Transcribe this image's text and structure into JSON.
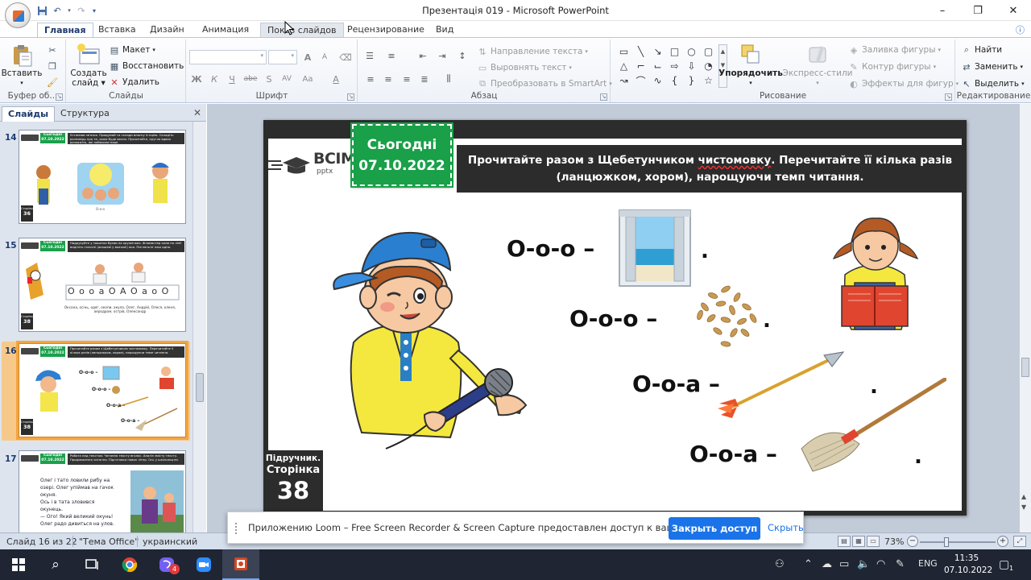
{
  "window": {
    "title": "Презентація 019 - Microsoft PowerPoint",
    "controls": {
      "minimize": "–",
      "maximize": "❐",
      "close": "✕"
    }
  },
  "qat": [
    "save-icon",
    "undo-icon",
    "redo-icon",
    "customize-icon"
  ],
  "ribbon_tabs": [
    "Главная",
    "Вставка",
    "Дизайн",
    "Анимация",
    "Показ слайдов",
    "Рецензирование",
    "Вид"
  ],
  "active_tab": "Главная",
  "ribbon": {
    "clipboard": {
      "label": "Буфер об...",
      "paste": "Вставить"
    },
    "slides": {
      "label": "Слайды",
      "create": "Создать",
      "create2": "слайд",
      "layout": "Макет",
      "reset": "Восстановить",
      "delete": "Удалить"
    },
    "font": {
      "label": "Шрифт",
      "grow": "A",
      "shrink": "A",
      "bold": "Ж",
      "italic": "К",
      "underline": "Ч",
      "strike": "abe",
      "shadow": "S",
      "spacing": "AV",
      "case": "Aa",
      "color": "A"
    },
    "paragraph": {
      "label": "Абзац",
      "text_direction": "Направление текста",
      "align_text": "Выровнять текст",
      "smartart": "Преобразовать в SmartArt"
    },
    "drawing": {
      "label": "Рисование",
      "arrange": "Упорядочить",
      "quick_styles": "Экспресс-стили",
      "fill": "Заливка фигуры",
      "outline": "Контур фигуры",
      "effects": "Эффекты для фигур"
    },
    "editing": {
      "label": "Редактирование",
      "find": "Найти",
      "replace": "Заменить",
      "select": "Выделить"
    }
  },
  "panel_tabs": [
    "Слайды",
    "Структура"
  ],
  "thumbnails": [
    {
      "num": "14",
      "bar_text": "Установи зв'язок. Придумай та склади власну історію. Складіть розповідь про те, якою буде весна. Прочитайте, кругло вдвох розкажіть, які побачили наші.",
      "page": "36"
    },
    {
      "num": "15",
      "bar_text": "Надрукуйте у зошитах букви на кружечках. Фломастер коли по лінії виділіть голосні (акашеві у вказані) яка. Погляньте наш одна.",
      "page": "38",
      "row": "О о о а О А О а о О",
      "caption": "Оксана, осінь, одяг, окопи, акула, Олег, Андрій, Олеся, оленя, аеродром, острів, Олександр"
    },
    {
      "num": "16",
      "bar_text": "Прочитайте разом з Щебетунчиком чистомовку. Перечитайте її кілька разів (ланцюжком, хором), нарощуючи темп читання.",
      "page": "38",
      "lines": [
        "О-о-о –",
        "О-о-о –",
        "О-о-а –",
        "О-о-а –"
      ]
    },
    {
      "num": "17",
      "bar_text": "Робота над текстом. Читання тексту вголос. Аналіз змісту тексту. Продовження читання. Підготовка нових літер. Ось у шкільництві.",
      "page": "38",
      "text_lines": [
        "Олег і тато ловили рибу на",
        "озері. Олег упіймав на гачок",
        "окуня.",
        "Ось і в тата зловився",
        "окунець.",
        "— Ого! Який великий окунь!",
        "Олег радо дивиться на улов."
      ]
    }
  ],
  "slide": {
    "brand": {
      "name": "ВСІМ",
      "sub": "pptx"
    },
    "date_badge": {
      "line1": "Сьогодні",
      "line2": "07.10.2022"
    },
    "instruction": {
      "part1": "Прочитайте разом з Щебетунчиком ",
      "underlined": "чистомовку",
      "part2": ". Перечитайте її кілька разів (ланцюжком, хором), нарощуючи темп читання."
    },
    "lines": [
      {
        "text": "О-о-о –",
        "picture": "window"
      },
      {
        "text": "О-о-о –",
        "picture": "oats"
      },
      {
        "text": "О-о-а –",
        "picture": "arrow"
      },
      {
        "text": "О-о-а –",
        "picture": "broom"
      }
    ],
    "dot": ".",
    "page_box": {
      "line1": "Підручник.",
      "line2": "Сторінка",
      "number": "38"
    }
  },
  "notification": {
    "message": "Приложению Loom – Free Screen Recorder & Screen Capture предоставлен доступ к вашему экрану.",
    "allow": "Закрыть доступ",
    "hide": "Скрыть"
  },
  "status": {
    "slide": "Слайд 16 из 22",
    "theme": "\"Тема Office\"",
    "lang": "украинский",
    "zoom": "73%"
  },
  "taskbar": {
    "apps": [
      "windows-icon",
      "search-icon",
      "task-view-icon",
      "chrome-icon",
      "viber-icon",
      "zoom-icon",
      "powerpoint-icon"
    ],
    "viber_badge": "4",
    "lang": "ENG",
    "time": "11:35",
    "date": "07.10.2022",
    "notif_count": "1"
  },
  "colors": {
    "accent": "#19a049",
    "dark": "#2c2c2c",
    "ribbon": "#eef2f8",
    "selection": "#f2a640",
    "link": "#1a73e8"
  }
}
